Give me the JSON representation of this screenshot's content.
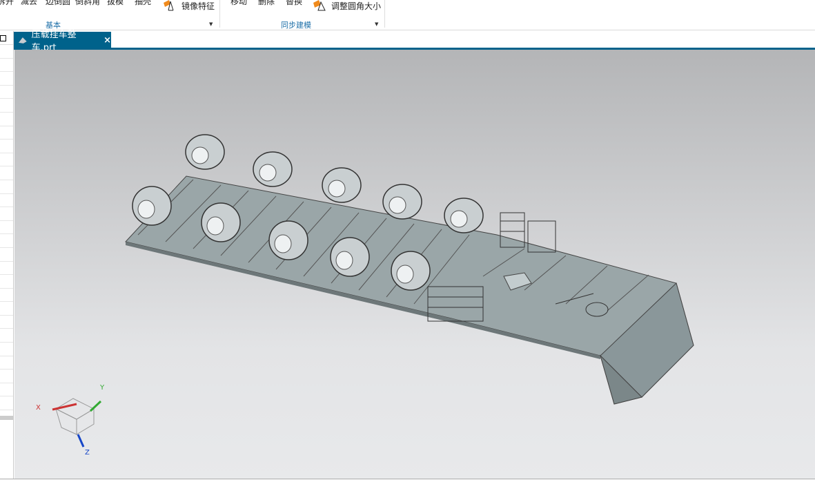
{
  "ribbon": {
    "buttons": [
      "拆开",
      "减去",
      "边倒圆",
      "倒斜角",
      "拔模",
      "抽壳",
      "镜像特征",
      "移动",
      "删除",
      "替换",
      "调整圆角大小"
    ],
    "groups": [
      "基本",
      "同步建模"
    ]
  },
  "tabs": [
    {
      "label": "压载挂车整车.prt",
      "close": "×"
    }
  ],
  "triad": {
    "x": "X",
    "y": "Y",
    "z": "Z"
  },
  "colors": {
    "accent": "#00628b",
    "viewport_top": "#b4b5b7",
    "viewport_bottom": "#e8e9eb"
  }
}
